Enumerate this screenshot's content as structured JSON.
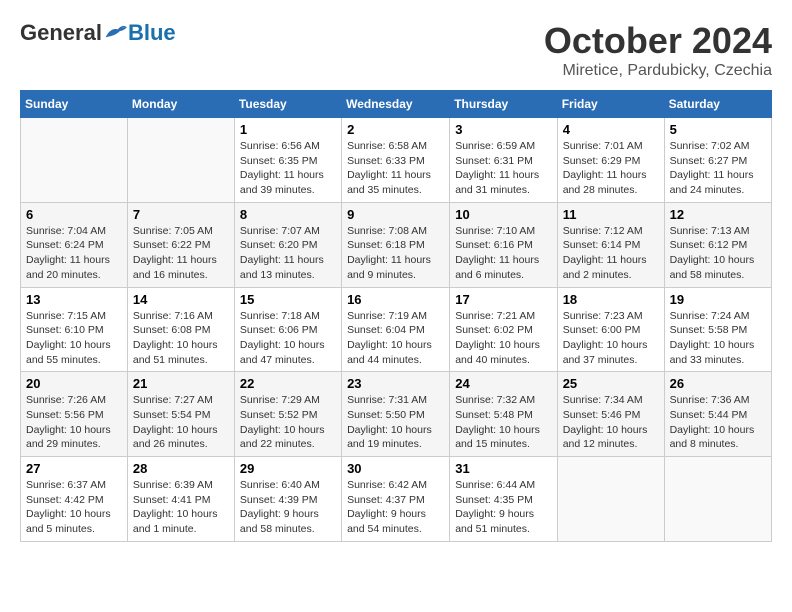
{
  "header": {
    "logo_general": "General",
    "logo_blue": "Blue",
    "title": "October 2024",
    "subtitle": "Miretice, Pardubicky, Czechia"
  },
  "days_of_week": [
    "Sunday",
    "Monday",
    "Tuesday",
    "Wednesday",
    "Thursday",
    "Friday",
    "Saturday"
  ],
  "weeks": [
    [
      {
        "day": "",
        "info": ""
      },
      {
        "day": "",
        "info": ""
      },
      {
        "day": "1",
        "info": "Sunrise: 6:56 AM\nSunset: 6:35 PM\nDaylight: 11 hours and 39 minutes."
      },
      {
        "day": "2",
        "info": "Sunrise: 6:58 AM\nSunset: 6:33 PM\nDaylight: 11 hours and 35 minutes."
      },
      {
        "day": "3",
        "info": "Sunrise: 6:59 AM\nSunset: 6:31 PM\nDaylight: 11 hours and 31 minutes."
      },
      {
        "day": "4",
        "info": "Sunrise: 7:01 AM\nSunset: 6:29 PM\nDaylight: 11 hours and 28 minutes."
      },
      {
        "day": "5",
        "info": "Sunrise: 7:02 AM\nSunset: 6:27 PM\nDaylight: 11 hours and 24 minutes."
      }
    ],
    [
      {
        "day": "6",
        "info": "Sunrise: 7:04 AM\nSunset: 6:24 PM\nDaylight: 11 hours and 20 minutes."
      },
      {
        "day": "7",
        "info": "Sunrise: 7:05 AM\nSunset: 6:22 PM\nDaylight: 11 hours and 16 minutes."
      },
      {
        "day": "8",
        "info": "Sunrise: 7:07 AM\nSunset: 6:20 PM\nDaylight: 11 hours and 13 minutes."
      },
      {
        "day": "9",
        "info": "Sunrise: 7:08 AM\nSunset: 6:18 PM\nDaylight: 11 hours and 9 minutes."
      },
      {
        "day": "10",
        "info": "Sunrise: 7:10 AM\nSunset: 6:16 PM\nDaylight: 11 hours and 6 minutes."
      },
      {
        "day": "11",
        "info": "Sunrise: 7:12 AM\nSunset: 6:14 PM\nDaylight: 11 hours and 2 minutes."
      },
      {
        "day": "12",
        "info": "Sunrise: 7:13 AM\nSunset: 6:12 PM\nDaylight: 10 hours and 58 minutes."
      }
    ],
    [
      {
        "day": "13",
        "info": "Sunrise: 7:15 AM\nSunset: 6:10 PM\nDaylight: 10 hours and 55 minutes."
      },
      {
        "day": "14",
        "info": "Sunrise: 7:16 AM\nSunset: 6:08 PM\nDaylight: 10 hours and 51 minutes."
      },
      {
        "day": "15",
        "info": "Sunrise: 7:18 AM\nSunset: 6:06 PM\nDaylight: 10 hours and 47 minutes."
      },
      {
        "day": "16",
        "info": "Sunrise: 7:19 AM\nSunset: 6:04 PM\nDaylight: 10 hours and 44 minutes."
      },
      {
        "day": "17",
        "info": "Sunrise: 7:21 AM\nSunset: 6:02 PM\nDaylight: 10 hours and 40 minutes."
      },
      {
        "day": "18",
        "info": "Sunrise: 7:23 AM\nSunset: 6:00 PM\nDaylight: 10 hours and 37 minutes."
      },
      {
        "day": "19",
        "info": "Sunrise: 7:24 AM\nSunset: 5:58 PM\nDaylight: 10 hours and 33 minutes."
      }
    ],
    [
      {
        "day": "20",
        "info": "Sunrise: 7:26 AM\nSunset: 5:56 PM\nDaylight: 10 hours and 29 minutes."
      },
      {
        "day": "21",
        "info": "Sunrise: 7:27 AM\nSunset: 5:54 PM\nDaylight: 10 hours and 26 minutes."
      },
      {
        "day": "22",
        "info": "Sunrise: 7:29 AM\nSunset: 5:52 PM\nDaylight: 10 hours and 22 minutes."
      },
      {
        "day": "23",
        "info": "Sunrise: 7:31 AM\nSunset: 5:50 PM\nDaylight: 10 hours and 19 minutes."
      },
      {
        "day": "24",
        "info": "Sunrise: 7:32 AM\nSunset: 5:48 PM\nDaylight: 10 hours and 15 minutes."
      },
      {
        "day": "25",
        "info": "Sunrise: 7:34 AM\nSunset: 5:46 PM\nDaylight: 10 hours and 12 minutes."
      },
      {
        "day": "26",
        "info": "Sunrise: 7:36 AM\nSunset: 5:44 PM\nDaylight: 10 hours and 8 minutes."
      }
    ],
    [
      {
        "day": "27",
        "info": "Sunrise: 6:37 AM\nSunset: 4:42 PM\nDaylight: 10 hours and 5 minutes."
      },
      {
        "day": "28",
        "info": "Sunrise: 6:39 AM\nSunset: 4:41 PM\nDaylight: 10 hours and 1 minute."
      },
      {
        "day": "29",
        "info": "Sunrise: 6:40 AM\nSunset: 4:39 PM\nDaylight: 9 hours and 58 minutes."
      },
      {
        "day": "30",
        "info": "Sunrise: 6:42 AM\nSunset: 4:37 PM\nDaylight: 9 hours and 54 minutes."
      },
      {
        "day": "31",
        "info": "Sunrise: 6:44 AM\nSunset: 4:35 PM\nDaylight: 9 hours and 51 minutes."
      },
      {
        "day": "",
        "info": ""
      },
      {
        "day": "",
        "info": ""
      }
    ]
  ]
}
